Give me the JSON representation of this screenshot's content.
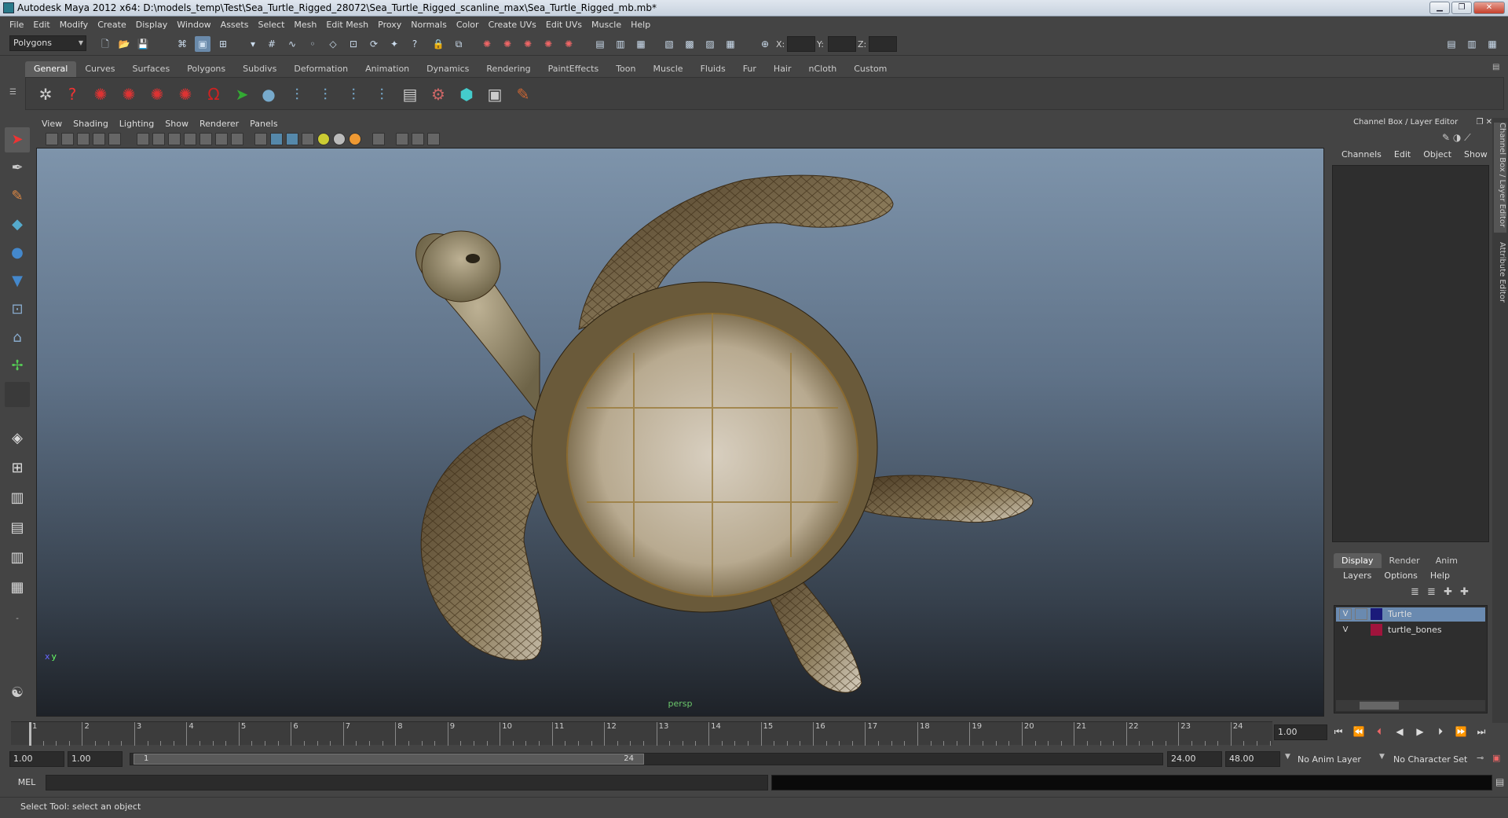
{
  "window": {
    "title": "Autodesk Maya 2012 x64: D:\\models_temp\\Test\\Sea_Turtle_Rigged_28072\\Sea_Turtle_Rigged_scanline_max\\Sea_Turtle_Rigged_mb.mb*"
  },
  "menu": [
    "File",
    "Edit",
    "Modify",
    "Create",
    "Display",
    "Window",
    "Assets",
    "Select",
    "Mesh",
    "Edit Mesh",
    "Proxy",
    "Normals",
    "Color",
    "Create UVs",
    "Edit UVs",
    "Muscle",
    "Help"
  ],
  "status_line": {
    "mode": "Polygons",
    "x_label": "X:",
    "y_label": "Y:",
    "z_label": "Z:"
  },
  "shelf": {
    "tabs": [
      "General",
      "Curves",
      "Surfaces",
      "Polygons",
      "Subdivs",
      "Deformation",
      "Animation",
      "Dynamics",
      "Rendering",
      "PaintEffects",
      "Toon",
      "Muscle",
      "Fluids",
      "Fur",
      "Hair",
      "nCloth",
      "Custom"
    ],
    "active": "General"
  },
  "panel_menu": [
    "View",
    "Shading",
    "Lighting",
    "Show",
    "Renderer",
    "Panels"
  ],
  "viewport": {
    "camera_label": "persp",
    "axis_x": "x",
    "axis_y": "y"
  },
  "channel_box": {
    "title": "Channel Box / Layer Editor",
    "menu": [
      "Channels",
      "Edit",
      "Object",
      "Show"
    ]
  },
  "layer_editor": {
    "tabs": [
      "Display",
      "Render",
      "Anim"
    ],
    "active_tab": "Display",
    "menu": [
      "Layers",
      "Options",
      "Help"
    ],
    "layers": [
      {
        "visible": "V",
        "name": "Turtle",
        "color": "#1a1a7a",
        "selected": true
      },
      {
        "visible": "V",
        "name": "turtle_bones",
        "color": "#a0143c",
        "selected": false
      }
    ]
  },
  "side_tabs": [
    "Channel Box / Layer Editor",
    "Attribute Editor"
  ],
  "time_slider": {
    "ticks": [
      "1",
      "2",
      "3",
      "4",
      "5",
      "6",
      "7",
      "8",
      "9",
      "10",
      "11",
      "12",
      "13",
      "14",
      "15",
      "16",
      "17",
      "18",
      "19",
      "20",
      "21",
      "22",
      "23",
      "24"
    ],
    "current_frame": "1.00"
  },
  "range_slider": {
    "start_time": "1.00",
    "playback_start": "1.00",
    "range_start_label": "1",
    "range_end_label": "24",
    "playback_end": "24.00",
    "end_time": "48.00",
    "anim_layer": "No Anim Layer",
    "character_set": "No Character Set"
  },
  "command_line": {
    "label": "MEL"
  },
  "help_line": {
    "text": "Select Tool: select an object"
  }
}
